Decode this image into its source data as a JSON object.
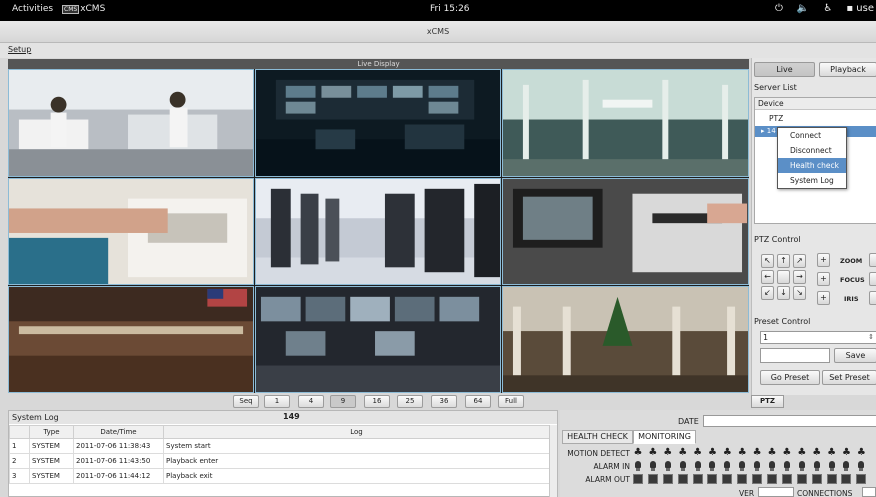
{
  "topbar": {
    "activities": "Activities",
    "app_badge": "CMS",
    "app_name": "xCMS",
    "clock": "Fri 15:26",
    "user": "use"
  },
  "window": {
    "title": "xCMS"
  },
  "menu": {
    "setup": "Setup"
  },
  "live": {
    "header": "Live Display"
  },
  "cameras": [
    {
      "id": "cam-1",
      "scene": "laboratory"
    },
    {
      "id": "cam-2",
      "scene": "control-room"
    },
    {
      "id": "cam-3",
      "scene": "shopping-mall"
    },
    {
      "id": "cam-4",
      "scene": "atm-hand"
    },
    {
      "id": "cam-5",
      "scene": "server-room"
    },
    {
      "id": "cam-6",
      "scene": "atm-card"
    },
    {
      "id": "cam-7",
      "scene": "stock-exchange"
    },
    {
      "id": "cam-8",
      "scene": "broadcast-room"
    },
    {
      "id": "cam-9",
      "scene": "mall-christmas"
    }
  ],
  "seq_bar": {
    "buttons": [
      "Seq",
      "1",
      "4",
      "9",
      "16",
      "25",
      "36",
      "64",
      "Full"
    ],
    "active": "9"
  },
  "system_log": {
    "title": "System Log",
    "count": "149",
    "columns": [
      "",
      "Type",
      "Date/Time",
      "Log"
    ],
    "rows": [
      {
        "no": "1",
        "type": "SYSTEM",
        "datetime": "2011-07-06 11:38:43",
        "log": "System start"
      },
      {
        "no": "2",
        "type": "SYSTEM",
        "datetime": "2011-07-06 11:43:50",
        "log": "Playback enter"
      },
      {
        "no": "3",
        "type": "SYSTEM",
        "datetime": "2011-07-06 11:44:12",
        "log": "Playback exit"
      }
    ]
  },
  "monitor": {
    "date_label": "DATE",
    "tabs": [
      "HEALTH CHECK",
      "MONITORING"
    ],
    "selected_tab": "MONITORING",
    "rows": [
      "MOTION DETECT",
      "ALARM IN",
      "ALARM OUT"
    ],
    "channel_count": 16,
    "ver_label": "VER",
    "connections_label": "CONNECTIONS"
  },
  "right_panel": {
    "live_button": "Live",
    "playback_button": "Playback",
    "server_list_label": "Server List",
    "device_header": "Device",
    "tree_items": [
      "PTZ"
    ],
    "selected_node": "14",
    "context_menu": [
      "Connect",
      "Disconnect",
      "Health check",
      "System Log"
    ],
    "context_highlight": "Health check",
    "ptz_control_label": "PTZ Control",
    "ptz_arrows": [
      "↖",
      "↑",
      "↗",
      "←",
      "",
      "→",
      "↙",
      "↓",
      "↘"
    ],
    "ptz_plus": "+",
    "ptz_labels": [
      "ZOOM",
      "FOCUS",
      "IRIS"
    ],
    "preset_control_label": "Preset Control",
    "preset_value": "1",
    "preset_arrow": "⇕",
    "save_button": "Save",
    "go_preset_button": "Go Preset",
    "set_preset_button": "Set Preset",
    "ptz_tab": "PTZ"
  },
  "tray_icons": [
    "power-icon",
    "volume-icon",
    "accessibility-icon",
    "chat-icon"
  ]
}
